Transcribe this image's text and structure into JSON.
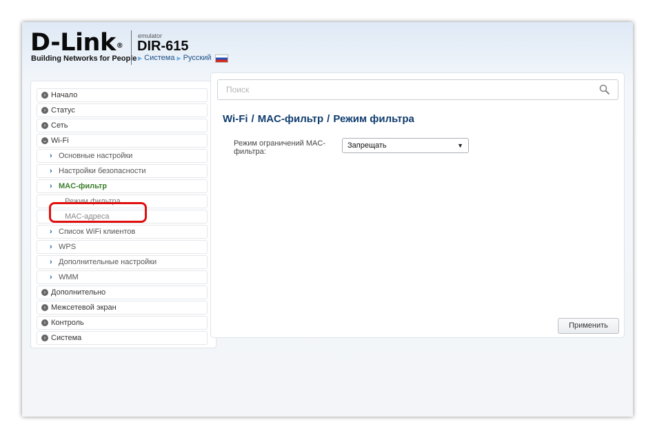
{
  "header": {
    "logo": "D-Link",
    "logo_mark": "®",
    "tagline": "Building Networks for People",
    "emulator": "emulator",
    "model": "DIR-615",
    "nav_system": "Система",
    "nav_language": "Русский"
  },
  "sidebar": {
    "items": [
      {
        "label": "Начало"
      },
      {
        "label": "Статус"
      },
      {
        "label": "Сеть"
      },
      {
        "label": "Wi-Fi"
      },
      {
        "label": "Основные настройки"
      },
      {
        "label": "Настройки безопасности"
      },
      {
        "label": "MAC-фильтр"
      },
      {
        "label": "Режим фильтра"
      },
      {
        "label": "MAC-адреса"
      },
      {
        "label": "Список WiFi клиентов"
      },
      {
        "label": "WPS"
      },
      {
        "label": "Дополнительные настройки"
      },
      {
        "label": "WMM"
      },
      {
        "label": "Дополнительно"
      },
      {
        "label": "Межсетевой экран"
      },
      {
        "label": "Контроль"
      },
      {
        "label": "Система"
      }
    ],
    "highlighted_item": "MAC-адреса",
    "highlight_color": "#e10e0e"
  },
  "search": {
    "placeholder": "Поиск"
  },
  "breadcrumb": {
    "part1": "Wi-Fi",
    "part2": "MAC-фильтр",
    "part3": "Режим фильтра",
    "separator": "/"
  },
  "form": {
    "mode_label": "Режим ограничений MAC-фильтра:",
    "mode_value": "Запрещать"
  },
  "buttons": {
    "apply": "Применить"
  },
  "colors": {
    "active_menu": "#3a7d2b",
    "title": "#0f3c6e"
  }
}
